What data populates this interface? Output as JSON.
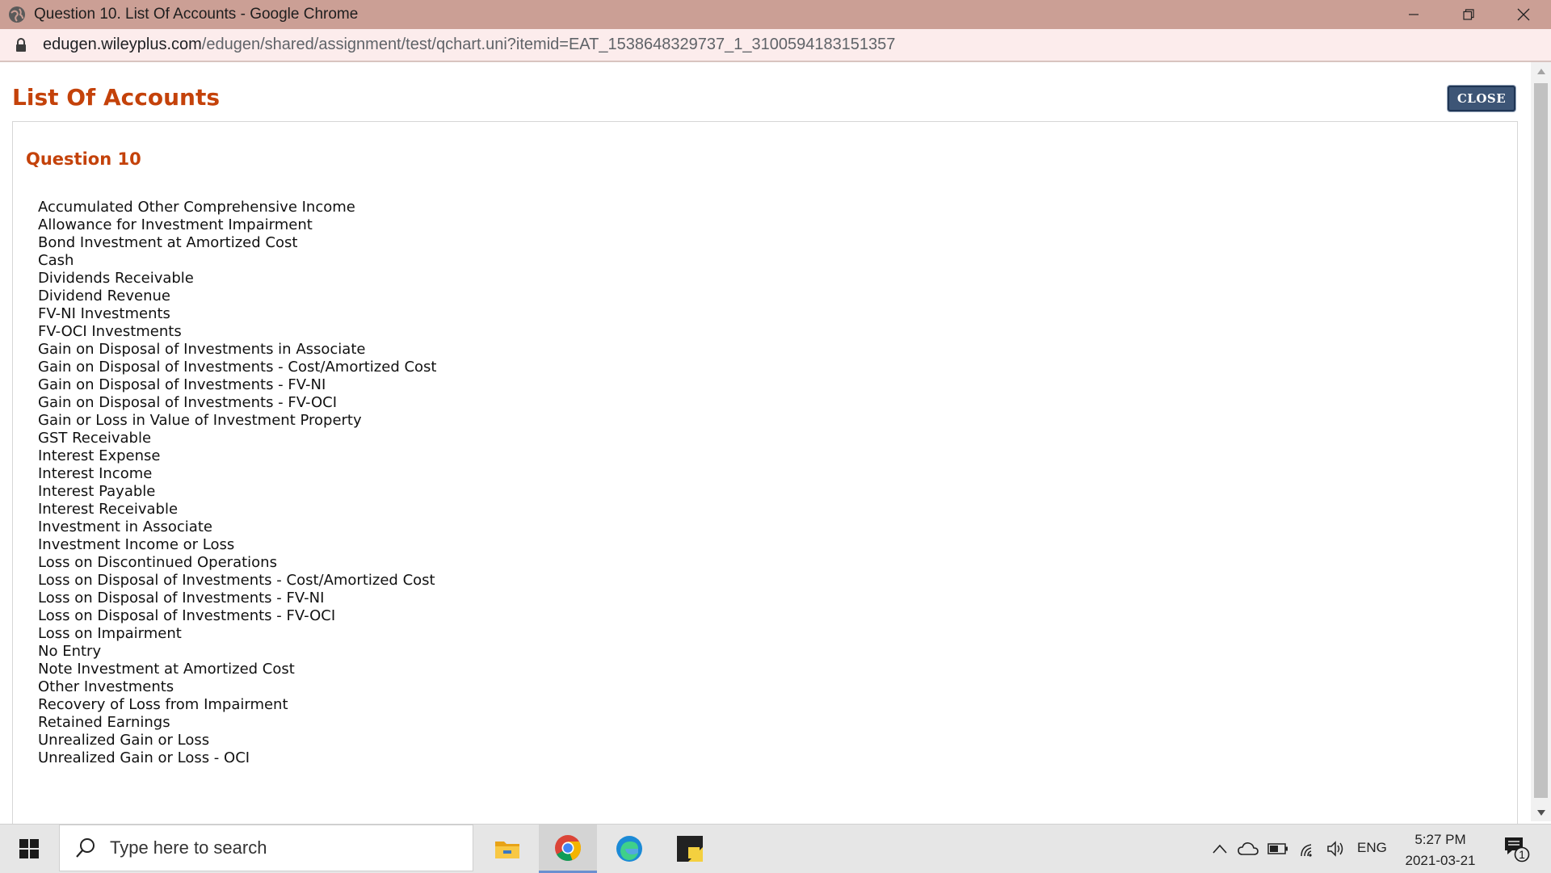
{
  "window": {
    "title": "Question 10. List Of Accounts - Google Chrome",
    "controls": {
      "minimize": "─",
      "restore": "❐",
      "close": "✕"
    }
  },
  "address_bar": {
    "host": "edugen.wileyplus.com",
    "path": "/edugen/shared/assignment/test/qchart.uni?itemid=EAT_1538648329737_1_3100594183151357"
  },
  "page": {
    "title": "List Of Accounts",
    "close_label": "CLOSE",
    "question_heading": "Question 10",
    "accounts": [
      "Accumulated Other Comprehensive Income",
      "Allowance for Investment Impairment",
      "Bond Investment at Amortized Cost",
      "Cash",
      "Dividends Receivable",
      "Dividend Revenue",
      "FV-NI Investments",
      "FV-OCI Investments",
      "Gain on Disposal of Investments in Associate",
      "Gain on Disposal of Investments - Cost/Amortized Cost",
      "Gain on Disposal of Investments - FV-NI",
      "Gain on Disposal of Investments - FV-OCI",
      "Gain or Loss in Value of Investment Property",
      "GST Receivable",
      "Interest Expense",
      "Interest Income",
      "Interest Payable",
      "Interest Receivable",
      "Investment in Associate",
      "Investment Income or Loss",
      "Loss on Discontinued Operations",
      "Loss on Disposal of Investments - Cost/Amortized Cost",
      "Loss on Disposal of Investments - FV-NI",
      "Loss on Disposal of Investments - FV-OCI",
      "Loss on Impairment",
      "No Entry",
      "Note Investment at Amortized Cost",
      "Other Investments",
      "Recovery of Loss from Impairment",
      "Retained Earnings",
      "Unrealized Gain or Loss",
      "Unrealized Gain or Loss - OCI"
    ]
  },
  "taskbar": {
    "search_placeholder": "Type here to search",
    "language": "ENG",
    "time": "5:27 PM",
    "date": "2021-03-21",
    "notification_count": "1"
  },
  "colors": {
    "titlebar": "#cb9f95",
    "heading": "#c4420a",
    "close_button": "#3d5576"
  }
}
